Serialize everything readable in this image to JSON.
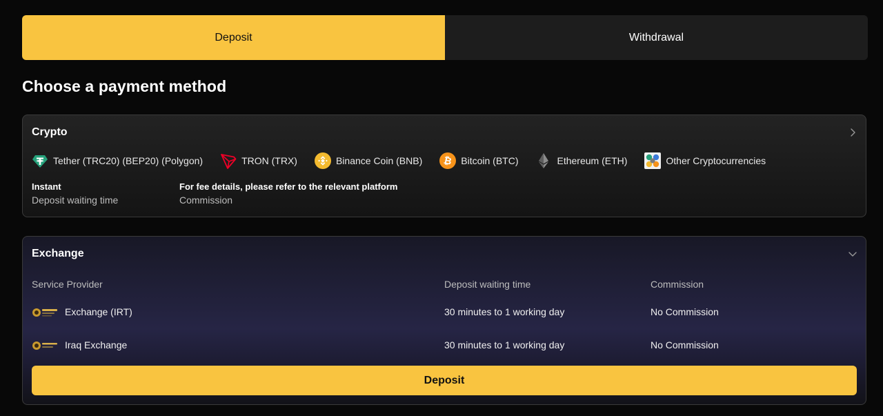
{
  "tabs": [
    {
      "label": "Deposit",
      "active": true
    },
    {
      "label": "Withdrawal",
      "active": false
    }
  ],
  "heading": "Choose a payment method",
  "crypto": {
    "title": "Crypto",
    "coins": [
      {
        "label": "Tether (TRC20) (BEP20) (Polygon)",
        "icon": "tether-icon"
      },
      {
        "label": "TRON (TRX)",
        "icon": "tron-icon"
      },
      {
        "label": "Binance Coin (BNB)",
        "icon": "bnb-icon"
      },
      {
        "label": "Bitcoin (BTC)",
        "icon": "bitcoin-icon"
      },
      {
        "label": "Ethereum (ETH)",
        "icon": "ethereum-icon"
      },
      {
        "label": "Other Cryptocurrencies",
        "icon": "other-crypto-icon"
      }
    ],
    "waiting_value": "Instant",
    "waiting_label": "Deposit waiting time",
    "commission_value": "For fee details, please refer to the relevant platform",
    "commission_label": "Commission"
  },
  "exchange": {
    "title": "Exchange",
    "columns": [
      "Service Provider",
      "Deposit waiting time",
      "Commission"
    ],
    "rows": [
      {
        "provider": "Exchange (IRT)",
        "waiting": "30 minutes to 1 working day",
        "commission": "No Commission"
      },
      {
        "provider": "Iraq Exchange",
        "waiting": "30 minutes to 1 working day",
        "commission": "No Commission"
      }
    ],
    "button_label": "Deposit"
  },
  "colors": {
    "accent": "#f9c440",
    "background": "#080808",
    "tab_inactive": "#1d1d1d",
    "tether": "#26a17b",
    "tron": "#ef0027",
    "bnb": "#f3ba2f",
    "bitcoin": "#f7931a"
  }
}
